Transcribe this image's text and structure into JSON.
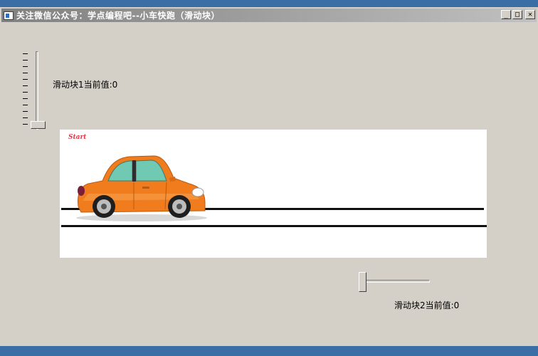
{
  "window": {
    "title": "关注微信公众号：学点编程吧--小车快跑（滑动块）",
    "buttons": {
      "minimize": "_",
      "maximize": "□",
      "close": "✕"
    }
  },
  "slider1": {
    "label": "滑动块1当前值:0",
    "value": 0,
    "orientation": "vertical"
  },
  "scene": {
    "start_text": "Start",
    "car_position": 0
  },
  "slider2": {
    "label": "滑动块2当前值:0",
    "value": 0,
    "orientation": "horizontal"
  },
  "colors": {
    "car_body": "#f07c1e",
    "window_glass": "#6fc9b3",
    "road": "#111111"
  }
}
